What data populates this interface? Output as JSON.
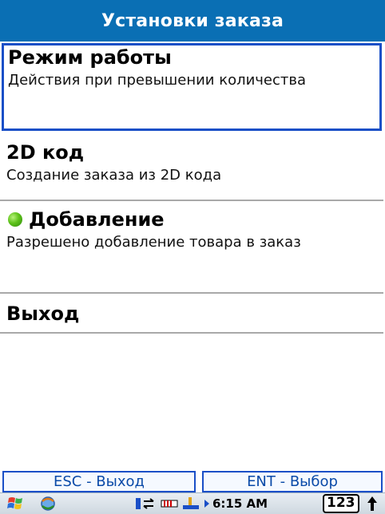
{
  "window": {
    "title": "Установки заказа"
  },
  "menu": {
    "items": [
      {
        "title": "Режим работы",
        "description": "Действия при превышении количества",
        "selected": true
      },
      {
        "title": "2D код",
        "description": "Создание заказа из 2D кода",
        "selected": false
      },
      {
        "title": "Добавление",
        "description": "Разрешено добавление товара в заказ",
        "selected": false,
        "status_icon": "green-dot-icon"
      },
      {
        "title": "Выход",
        "description": "",
        "selected": false
      }
    ]
  },
  "softkeys": {
    "left": "ESC - Выход",
    "right": "ENT - Выбор"
  },
  "taskbar": {
    "clock": "6:15 AM",
    "input_mode": "123",
    "icons": [
      "windows-start-icon",
      "sync-icon",
      "signal-icon",
      "connectivity-icon",
      "battery-icon",
      "arrow-icon",
      "up-arrow-icon"
    ]
  },
  "colors": {
    "title_bar": "#0a6fb4",
    "selection_border": "#1a4fc7",
    "status_dot": "#5ec21a"
  }
}
